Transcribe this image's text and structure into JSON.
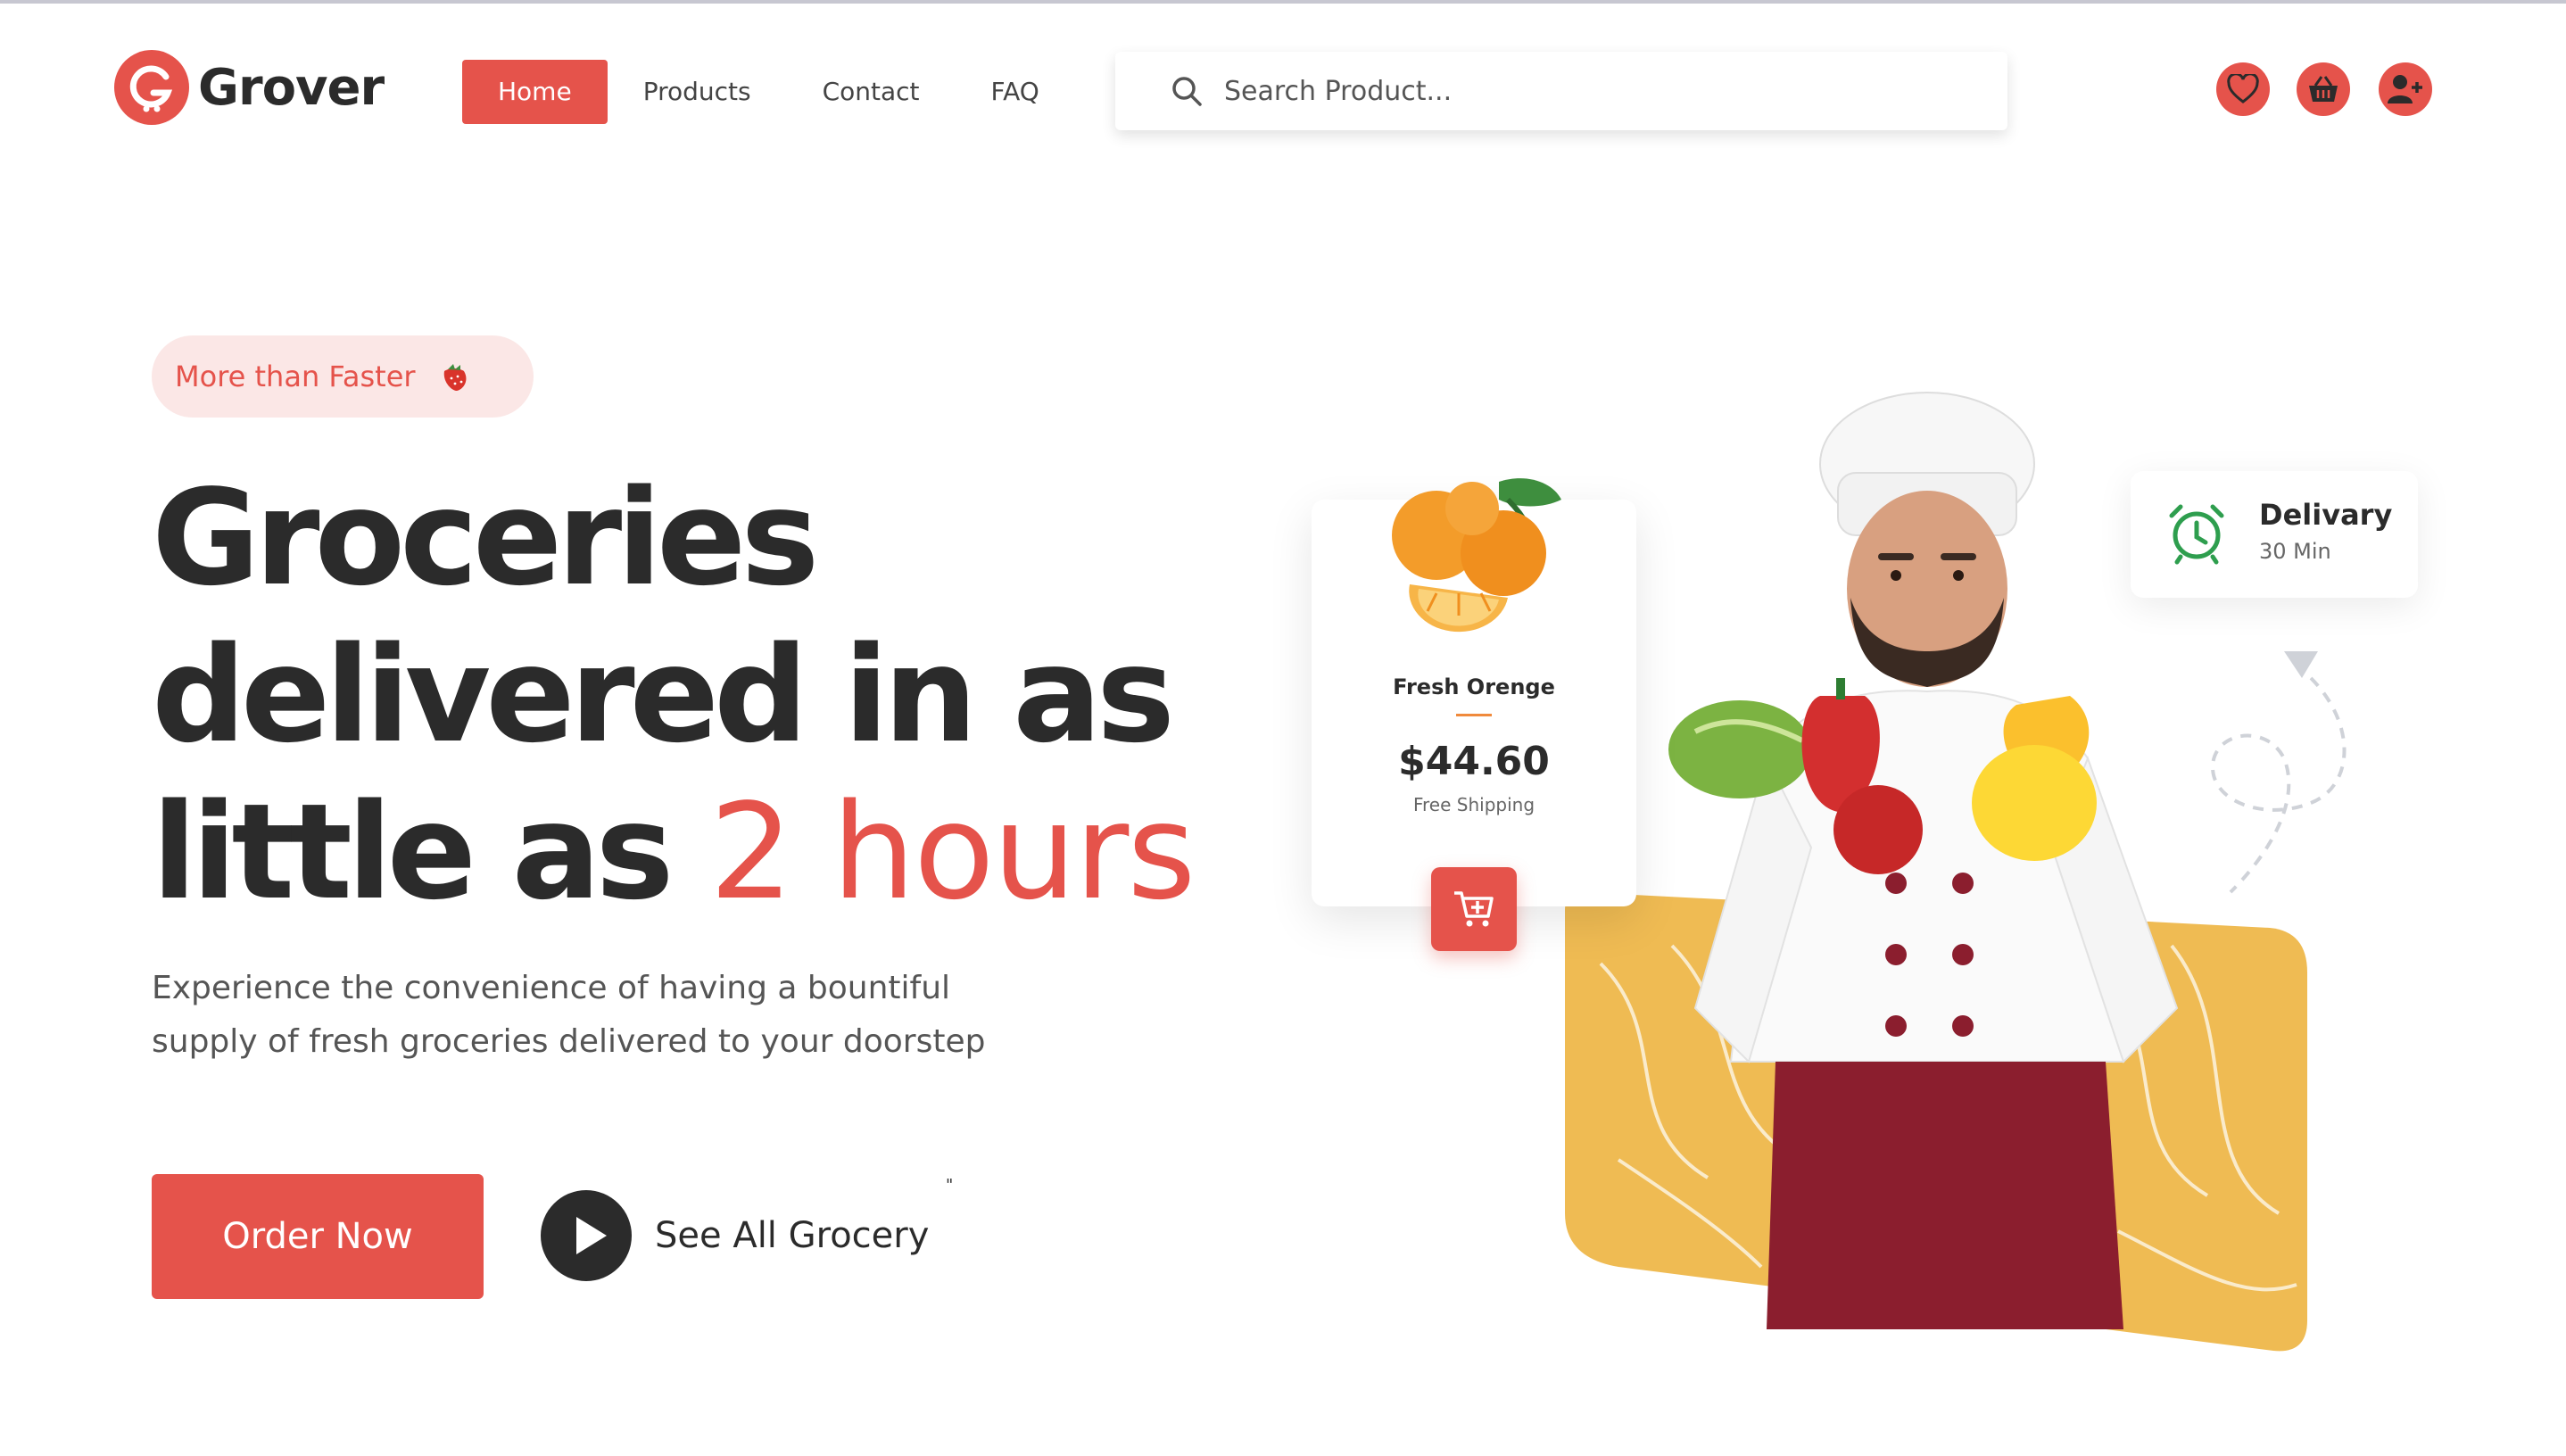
{
  "brand": {
    "name": "Grover",
    "accent": "#e5534b",
    "dark": "#2b2b2b",
    "yellow": "#efbb53"
  },
  "nav": {
    "items": [
      {
        "label": "Home",
        "active": true
      },
      {
        "label": "Products",
        "active": false
      },
      {
        "label": "Contact",
        "active": false
      },
      {
        "label": "FAQ",
        "active": false
      }
    ]
  },
  "search": {
    "placeholder": "Search Product...",
    "value": "",
    "icon": "search-icon"
  },
  "header_icons": [
    "heart-icon",
    "basket-icon",
    "user-plus-icon"
  ],
  "hero": {
    "badge": "More than Faster",
    "badge_icon": "strawberry-icon",
    "headline_line1": "Groceries",
    "headline_line2": "delivered in as",
    "headline_line3_prefix": "little as",
    "headline_line3_accent": "2 hours",
    "description_line1": "Experience the convenience of having a bountiful",
    "description_line2": "supply of fresh groceries delivered to your doorstep",
    "order_button": "Order Now",
    "see_all": "See All Grocery",
    "stray_mark": "\""
  },
  "product_card": {
    "name": "Fresh Orenge",
    "price": "$44.60",
    "shipping": "Free Shipping",
    "cart_icon": "cart-add-icon"
  },
  "delivery_card": {
    "title": "Delivary",
    "subtitle": "30 Min",
    "icon": "alarm-clock-icon"
  }
}
